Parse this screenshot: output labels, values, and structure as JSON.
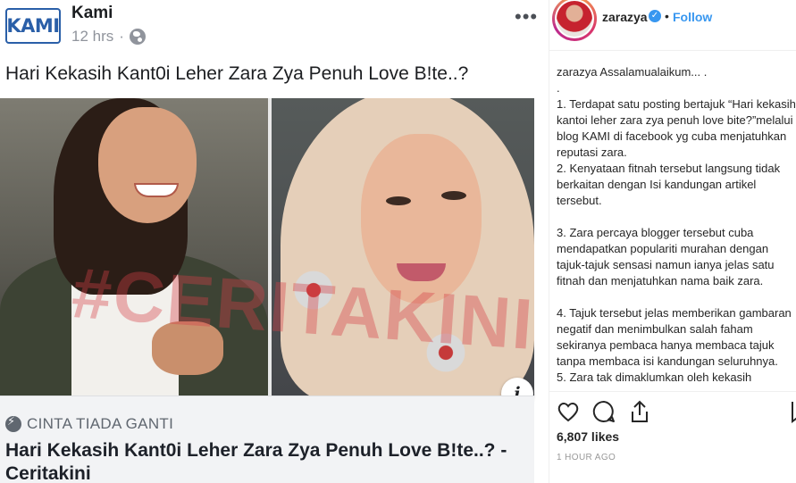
{
  "facebook": {
    "logo_text": "KAMI",
    "page_name": "Kami",
    "timestamp": "12 hrs",
    "separator": "·",
    "more_label": "•••",
    "post_text": "Hari Kekasih Kant0i Leher Zara Zya Penuh Love B!te..?",
    "image_watermark": "#CERITAKINI",
    "info_label": "i",
    "link_source": "CINTA TIADA GANTI",
    "link_title": "Hari Kekasih Kant0i Leher Zara Zya Penuh Love B!te..? - Ceritakini"
  },
  "instagram": {
    "username": "zarazya",
    "verified_mark": "✓",
    "dot": "•",
    "follow_label": "Follow",
    "caption_lines": [
      "zarazya Assalamualaikum... .",
      ".",
      "1. Terdapat satu posting bertajuk “Hari kekasih kantoi leher zara zya penuh love bite?”melalui blog KAMI di facebook yg cuba menjatuhkan reputasi zara.",
      "2. Kenyataan fitnah tersebut langsung tidak berkaitan dengan Isi kandungan artikel tersebut.",
      "",
      "3. Zara percaya blogger tersebut cuba mendapatkan populariti murahan dengan tajuk-tajuk sensasi namun ianya jelas satu fitnah dan menjatuhkan nama baik zara.",
      "",
      "4. Tajuk tersebut jelas memberikan gambaran negatif dan menimbulkan salah faham sekiranya pembaca hanya membaca tajuk tanpa membaca isi kandungan seluruhnya.",
      "5. Zara tak dimaklumkan oleh kekasih"
    ],
    "likes": "6,807 likes",
    "time_ago": "1 HOUR AGO"
  },
  "colors": {
    "fb_blue_logo": "#2a5fa8",
    "ig_blue": "#3897f0",
    "watermark_red": "#d64048"
  },
  "icons": [
    "globe-icon",
    "more-options-icon",
    "info-icon",
    "bolt-icon",
    "verified-icon",
    "heart-icon",
    "comment-icon",
    "share-icon",
    "bookmark-icon"
  ]
}
